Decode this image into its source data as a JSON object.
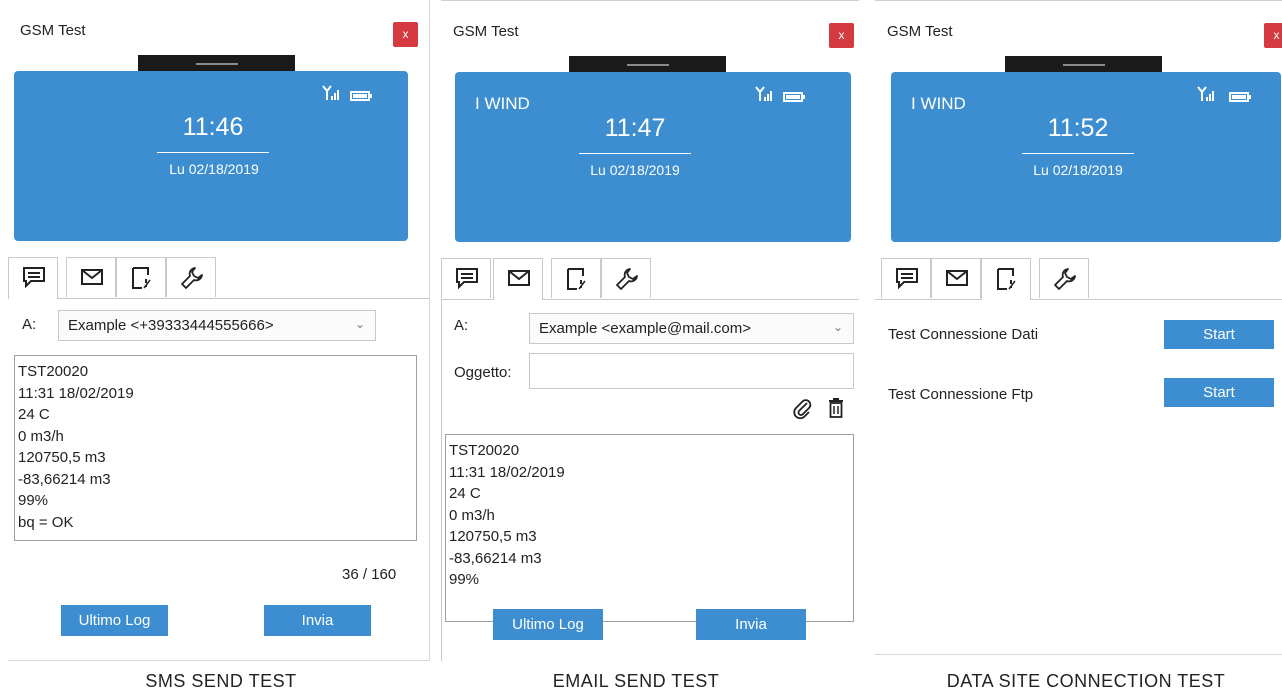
{
  "window_title": "GSM Test",
  "close_label": "x",
  "captions": [
    "SMS SEND TEST",
    "EMAIL SEND TEST",
    "DATA SITE CONNECTION TEST"
  ],
  "panels": {
    "sms": {
      "carrier": "",
      "time": "11:46",
      "date": "Lu 02/18/2019",
      "to_label": "A:",
      "to_value": "Example <+39333444555666>",
      "message_lines": [
        "TST20020",
        "11:31 18/02/2019",
        "24 C",
        "0 m3/h",
        "120750,5 m3",
        "-83,66214 m3",
        "99%",
        "bq = OK"
      ],
      "counter": "36 / 160",
      "btn_last_log": "Ultimo Log",
      "btn_send": "Invia"
    },
    "email": {
      "carrier": "I WIND",
      "time": "11:47",
      "date": "Lu 02/18/2019",
      "to_label": "A:",
      "to_value": "Example <example@mail.com>",
      "subject_label": "Oggetto:",
      "subject_value": "",
      "message_lines": [
        "TST20020",
        "11:31 18/02/2019",
        "24 C",
        "0 m3/h",
        "120750,5 m3",
        "-83,66214 m3",
        "99%"
      ],
      "btn_last_log": "Ultimo Log",
      "btn_send": "Invia"
    },
    "data": {
      "carrier": "I WIND",
      "time": "11:52",
      "date": "Lu 02/18/2019",
      "row1_label": "Test Connessione Dati",
      "row1_btn": "Start",
      "row2_label": "Test Connessione Ftp",
      "row2_btn": "Start"
    }
  },
  "colors": {
    "screen_blue": "#3d8ed1",
    "close_red": "#d43a3f"
  }
}
